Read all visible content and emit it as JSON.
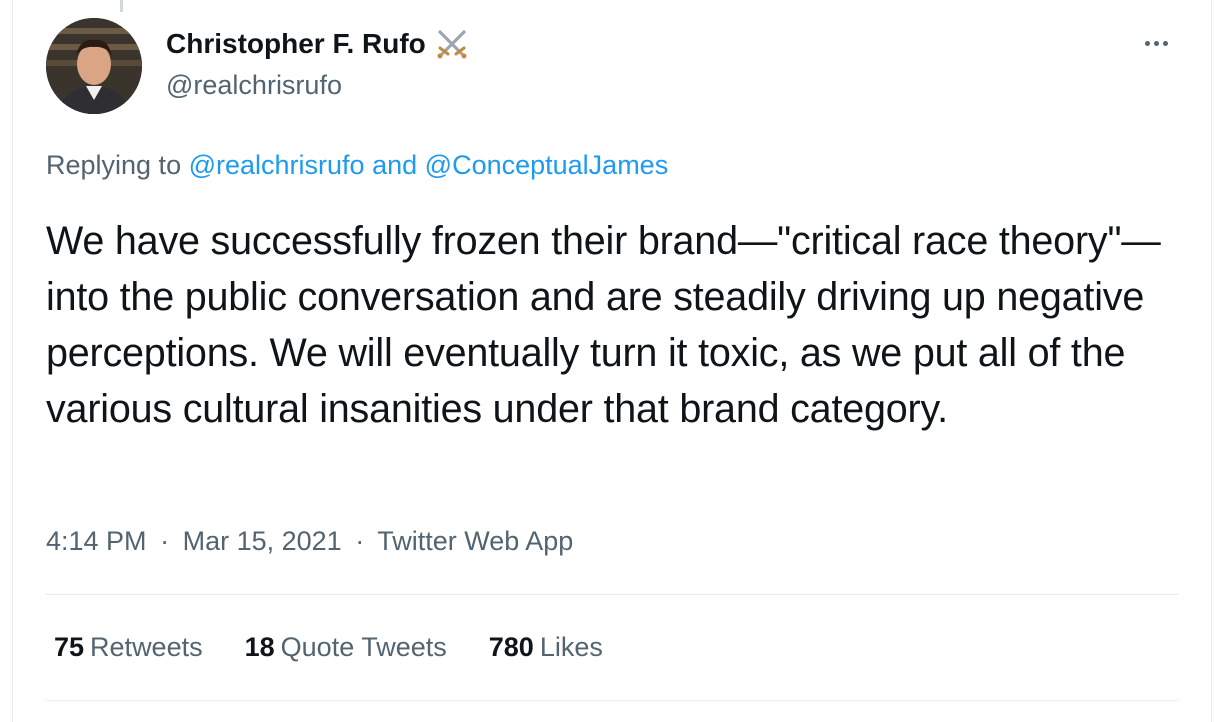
{
  "tweet": {
    "author": {
      "name": "Christopher F. Rufo",
      "handle": "@realchrisrufo",
      "name_emoji_icon": "crossed-swords-icon"
    },
    "reply": {
      "prefix": "Replying to",
      "mention1": "@realchrisrufo",
      "conjunction": "and",
      "mention2": "@ConceptualJames"
    },
    "text": "We have successfully frozen their brand—\"critical race theory\"—into the public conversation and are steadily driving up negative perceptions. We will eventually turn it toxic, as we put all of the various cultural insanities under that brand category.",
    "meta": {
      "time": "4:14 PM",
      "separator": "·",
      "date": "Mar 15, 2021",
      "app": "Twitter Web App"
    },
    "stats": {
      "retweets_count": "75",
      "retweets_label": "Retweets",
      "quotes_count": "18",
      "quotes_label": "Quote Tweets",
      "likes_count": "780",
      "likes_label": "Likes"
    }
  },
  "colors": {
    "link": "#1d9bf0",
    "secondary_text": "#536471",
    "primary_text": "#0f1419",
    "divider": "#e6ecf0"
  }
}
